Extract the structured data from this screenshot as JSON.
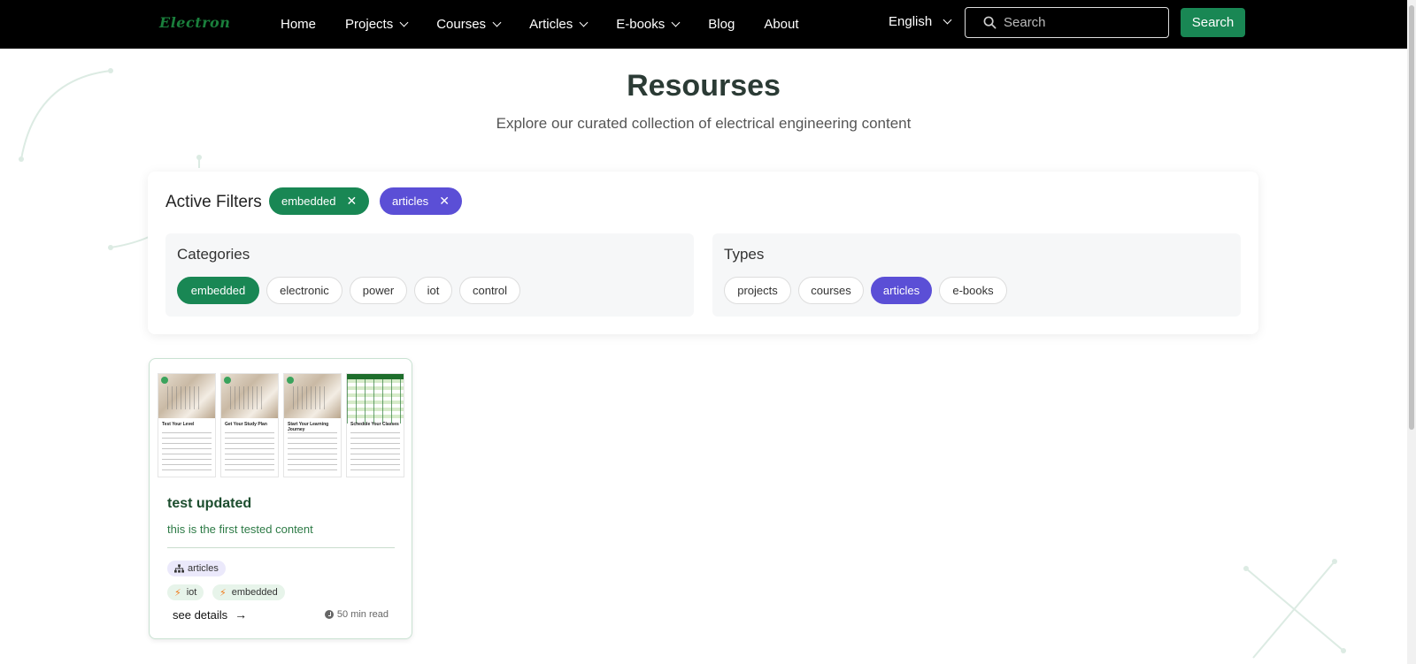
{
  "nav": {
    "logo": "Electron",
    "items": [
      {
        "label": "Home",
        "dropdown": false
      },
      {
        "label": "Projects",
        "dropdown": true
      },
      {
        "label": "Courses",
        "dropdown": true
      },
      {
        "label": "Articles",
        "dropdown": true
      },
      {
        "label": "E-books",
        "dropdown": true
      },
      {
        "label": "Blog",
        "dropdown": false
      },
      {
        "label": "About",
        "dropdown": false
      }
    ],
    "language": "English",
    "search_placeholder": "Search",
    "search_button": "Search"
  },
  "header": {
    "title": "Resourses",
    "subtitle": "Explore our curated collection of electrical engineering content"
  },
  "filters": {
    "active_label": "Active Filters",
    "active": [
      {
        "label": "embedded",
        "color": "#198754"
      },
      {
        "label": "articles",
        "color": "#5b4fd6"
      }
    ],
    "categories": {
      "title": "Categories",
      "items": [
        "embedded",
        "electronic",
        "power",
        "iot",
        "control"
      ],
      "selected": "embedded"
    },
    "types": {
      "title": "Types",
      "items": [
        "projects",
        "courses",
        "articles",
        "e-books"
      ],
      "selected": "articles"
    }
  },
  "cards": [
    {
      "title": "test updated",
      "description": "this is the first tested content",
      "type_tag": "articles",
      "category_tags": [
        "iot",
        "embedded"
      ],
      "link_label": "see details",
      "read_time": "50 min read",
      "thumbnail_panels": [
        "Test Your Level",
        "Get Your Study Plan",
        "Start Your Learning Journey",
        "Schedule Your Classes"
      ]
    }
  ],
  "colors": {
    "brand_green": "#198754",
    "accent_purple": "#5b4fd6",
    "nav_bg": "#000000"
  }
}
